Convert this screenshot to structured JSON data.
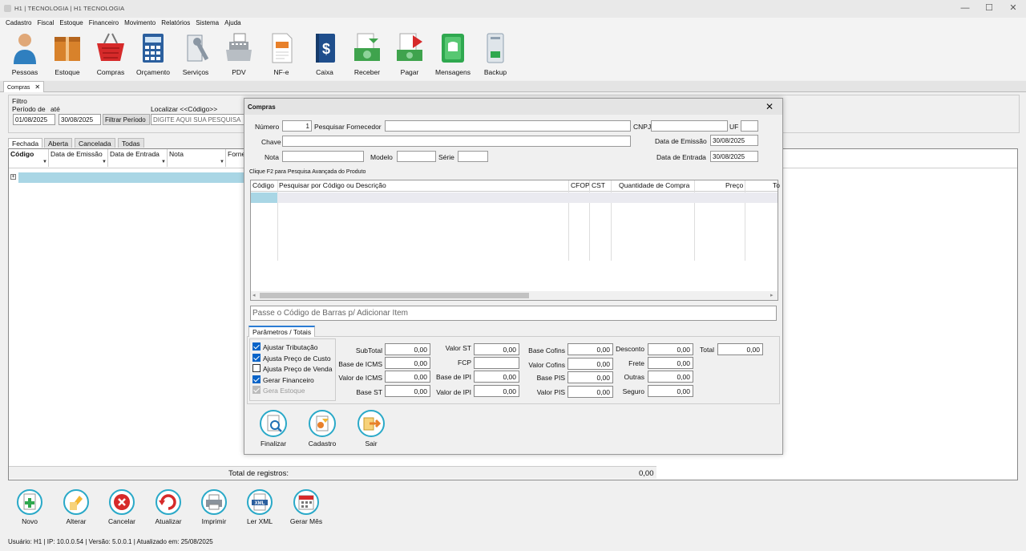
{
  "window": {
    "title": "H1 | TECNOLOGIA | H1 TECNOLOGIA",
    "minimize": "—",
    "maximize": "☐",
    "close": "✕"
  },
  "menu": [
    "Cadastro",
    "Fiscal",
    "Estoque",
    "Financeiro",
    "Movimento",
    "Relatórios",
    "Sistema",
    "Ajuda"
  ],
  "toolbar": [
    {
      "label": "Pessoas",
      "icon": "person-icon",
      "color": "#2f7fbf"
    },
    {
      "label": "Estoque",
      "icon": "boxes-icon",
      "color": "#d8822b"
    },
    {
      "label": "Compras",
      "icon": "shopping-basket-icon",
      "color": "#d62a2a"
    },
    {
      "label": "Orçamento",
      "icon": "calculator-icon",
      "color": "#2b5f9e"
    },
    {
      "label": "Serviços",
      "icon": "wrench-icon",
      "color": "#8a96a3"
    },
    {
      "label": "PDV",
      "icon": "cash-register-icon",
      "color": "#9aa0a6"
    },
    {
      "label": "NF-e",
      "icon": "invoice-icon",
      "color": "#e8802a"
    },
    {
      "label": "Caixa",
      "icon": "dollar-book-icon",
      "color": "#1f4e8c"
    },
    {
      "label": "Receber",
      "icon": "receive-money-icon",
      "color": "#3fa34d"
    },
    {
      "label": "Pagar",
      "icon": "pay-money-icon",
      "color": "#d62a2a"
    },
    {
      "label": "Mensagens",
      "icon": "message-icon",
      "color": "#2fa84f"
    },
    {
      "label": "Backup",
      "icon": "backup-drive-icon",
      "color": "#8fa0b0"
    }
  ],
  "doc_tab": {
    "label": "Compras",
    "close": "✕"
  },
  "filter": {
    "title": "Filtro",
    "period_label": "Período de",
    "until_label": "até",
    "date_from": "01/08/2025",
    "date_to": "30/08/2025",
    "filter_button": "Filtrar Período",
    "search_label": "Localizar <<Código>>",
    "search_placeholder": "DIGITE AQUI SUA PESQUISA"
  },
  "grid_tabs": [
    "Fechada",
    "Aberta",
    "Cancelada",
    "Todas"
  ],
  "grid_columns": [
    "Código",
    "Data de Emissão",
    "Data de Entrada",
    "Nota",
    "Forne"
  ],
  "grid_footer": {
    "label": "Total de registros:",
    "value": "0,00"
  },
  "bottom_buttons": [
    {
      "label": "Novo",
      "icon": "new-document-icon"
    },
    {
      "label": "Alterar",
      "icon": "edit-icon"
    },
    {
      "label": "Cancelar",
      "icon": "cancel-icon"
    },
    {
      "label": "Atualizar",
      "icon": "refresh-icon"
    },
    {
      "label": "Imprimir",
      "icon": "printer-icon"
    },
    {
      "label": "Ler XML",
      "icon": "xml-icon"
    },
    {
      "label": "Gerar Mês",
      "icon": "calendar-icon"
    }
  ],
  "status": "Usuário: H1 | IP: 10.0.0.54 | Versão: 5.0.0.1 | Atualizado em: 25/08/2025",
  "dialog": {
    "title": "Compras",
    "close": "✕",
    "numero_label": "Número",
    "numero_value": "1",
    "fornecedor_label": "Pesquisar Fornecedor",
    "cnpj_label": "CNPJ",
    "uf_label": "UF",
    "chave_label": "Chave",
    "data_emissao_label": "Data de Emissão",
    "data_emissao_value": "30/08/2025",
    "nota_label": "Nota",
    "modelo_label": "Modelo",
    "serie_label": "Série",
    "data_entrada_label": "Data de Entrada",
    "data_entrada_value": "30/08/2025",
    "hint": "Clique F2 para Pesquisa Avançada do Produto",
    "item_columns": [
      "Código",
      "Pesquisar por Código ou Descrição",
      "CFOP",
      "CST",
      "Quantidade de Compra",
      "Preço",
      "To"
    ],
    "barcode_placeholder": "Passe o Código de Barras  p/ Adicionar Item",
    "params_tab": "Parâmetros / Totais",
    "checks": [
      {
        "label": "Ajustar Tributação",
        "state": "on"
      },
      {
        "label": "Ajusta Preço de Custo",
        "state": "on"
      },
      {
        "label": "Ajusta Preço de Venda",
        "state": "off"
      },
      {
        "label": "Gerar Financeiro",
        "state": "on"
      },
      {
        "label": "Gera Estoque",
        "state": "disabled"
      }
    ],
    "totals_col1": [
      {
        "label": "SubTotal",
        "value": "0,00"
      },
      {
        "label": "Base de ICMS",
        "value": "0,00"
      },
      {
        "label": "Valor de ICMS",
        "value": "0,00"
      },
      {
        "label": "Base ST",
        "value": "0,00"
      }
    ],
    "totals_col2": [
      {
        "label": "Valor ST",
        "value": "0,00"
      },
      {
        "label": "FCP",
        "value": ""
      },
      {
        "label": "Base de IPI",
        "value": "0,00"
      },
      {
        "label": "Valor de IPI",
        "value": "0,00"
      }
    ],
    "totals_col3": [
      {
        "label": "Base Cofins",
        "value": "0,00"
      },
      {
        "label": "Valor Cofins",
        "value": "0,00"
      },
      {
        "label": "Base PIS",
        "value": "0,00"
      },
      {
        "label": "Valor PIS",
        "value": "0,00"
      }
    ],
    "totals_col4": [
      {
        "label": "Desconto",
        "value": "0,00"
      },
      {
        "label": "Frete",
        "value": "0,00"
      },
      {
        "label": "Outras",
        "value": "0,00"
      },
      {
        "label": "Seguro",
        "value": "0,00"
      }
    ],
    "total_label": "Total",
    "total_value": "0,00",
    "buttons": [
      {
        "label": "Finalizar",
        "icon": "finalize-icon"
      },
      {
        "label": "Cadastro",
        "icon": "register-icon"
      },
      {
        "label": "Sair",
        "icon": "exit-icon"
      }
    ]
  }
}
